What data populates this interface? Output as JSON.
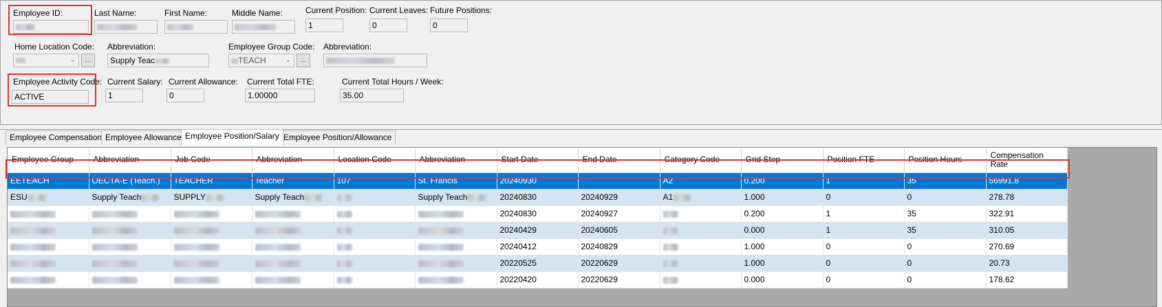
{
  "header": {
    "employee_id": {
      "label": "Employee ID:",
      "value": ""
    },
    "last_name": {
      "label": "Last Name:",
      "value": ""
    },
    "first_name": {
      "label": "First Name:",
      "value": ""
    },
    "middle_name": {
      "label": "Middle Name:",
      "value": ""
    },
    "current_position": {
      "label": "Current Position:",
      "value": "1"
    },
    "current_leaves": {
      "label": "Current Leaves:",
      "value": "0"
    },
    "future_positions": {
      "label": "Future Positions:",
      "value": "0"
    },
    "home_location_code": {
      "label": "Home Location Code:",
      "value": ""
    },
    "home_abbreviation": {
      "label": "Abbreviation:",
      "value": "Supply Teac"
    },
    "employee_group_code": {
      "label": "Employee Group Code:",
      "value": "TEACH"
    },
    "group_abbreviation": {
      "label": "Abbreviation:",
      "value": ""
    },
    "activity_code": {
      "label": "Employee Activity Code:",
      "value": "ACTIVE"
    },
    "current_salary": {
      "label": "Current Salary:",
      "value": "1"
    },
    "current_allowance": {
      "label": "Current Allowance:",
      "value": "0"
    },
    "current_total_fte": {
      "label": "Current Total FTE:",
      "value": "1.00000"
    },
    "current_total_hours": {
      "label": "Current Total Hours / Week:",
      "value": "35.00"
    },
    "ellipsis": "..."
  },
  "tabs": [
    {
      "label": "Employee Compensation"
    },
    {
      "label": "Employee Allowance"
    },
    {
      "label": "Employee Position/Salary"
    },
    {
      "label": "Employee Position/Allowance"
    }
  ],
  "grid": {
    "columns": [
      "Employee Group",
      "Abbreviation",
      "Job Code",
      "Abbreviation",
      "Location Code",
      "Abbreviation",
      "Start Date",
      "End Date",
      "Category Code",
      "Grid Step",
      "Position FTE",
      "Position Hours",
      "Compensation Rate"
    ],
    "rows": [
      [
        "EETEACH",
        "OECTA-E (Teach.)",
        "TEACHER",
        "Teacher",
        "107",
        "St. Francis",
        "20240930",
        "",
        "A2",
        "0.200",
        "1",
        "35",
        "56991.8"
      ],
      [
        "ESU",
        "Supply Teach",
        "SUPPLY",
        "Supply Teach",
        "",
        "Supply Teach",
        "20240830",
        "20240929",
        "A1",
        "1.000",
        "0",
        "0",
        "278.78"
      ],
      [
        "",
        "",
        "",
        "",
        "",
        "",
        "20240830",
        "20240927",
        "",
        "0.200",
        "1",
        "35",
        "322.91"
      ],
      [
        "",
        "",
        "",
        "",
        "",
        "",
        "20240429",
        "20240605",
        "",
        "0.000",
        "1",
        "35",
        "310.05"
      ],
      [
        "",
        "",
        "",
        "",
        "",
        "",
        "20240412",
        "20240829",
        "",
        "1.000",
        "0",
        "0",
        "270.69"
      ],
      [
        "",
        "",
        "",
        "",
        "",
        "",
        "20220525",
        "20220629",
        "",
        "1.000",
        "0",
        "0",
        "20.73"
      ],
      [
        "",
        "",
        "",
        "",
        "",
        "",
        "20220420",
        "20220629",
        "",
        "0.000",
        "0",
        "0",
        "178.62"
      ]
    ],
    "selected_row": 0
  },
  "colors": {
    "selection": "#0078d7",
    "alt_row": "#d6e3f1",
    "highlight_box": "#e03131",
    "grid_bg": "#a9a9a9"
  }
}
